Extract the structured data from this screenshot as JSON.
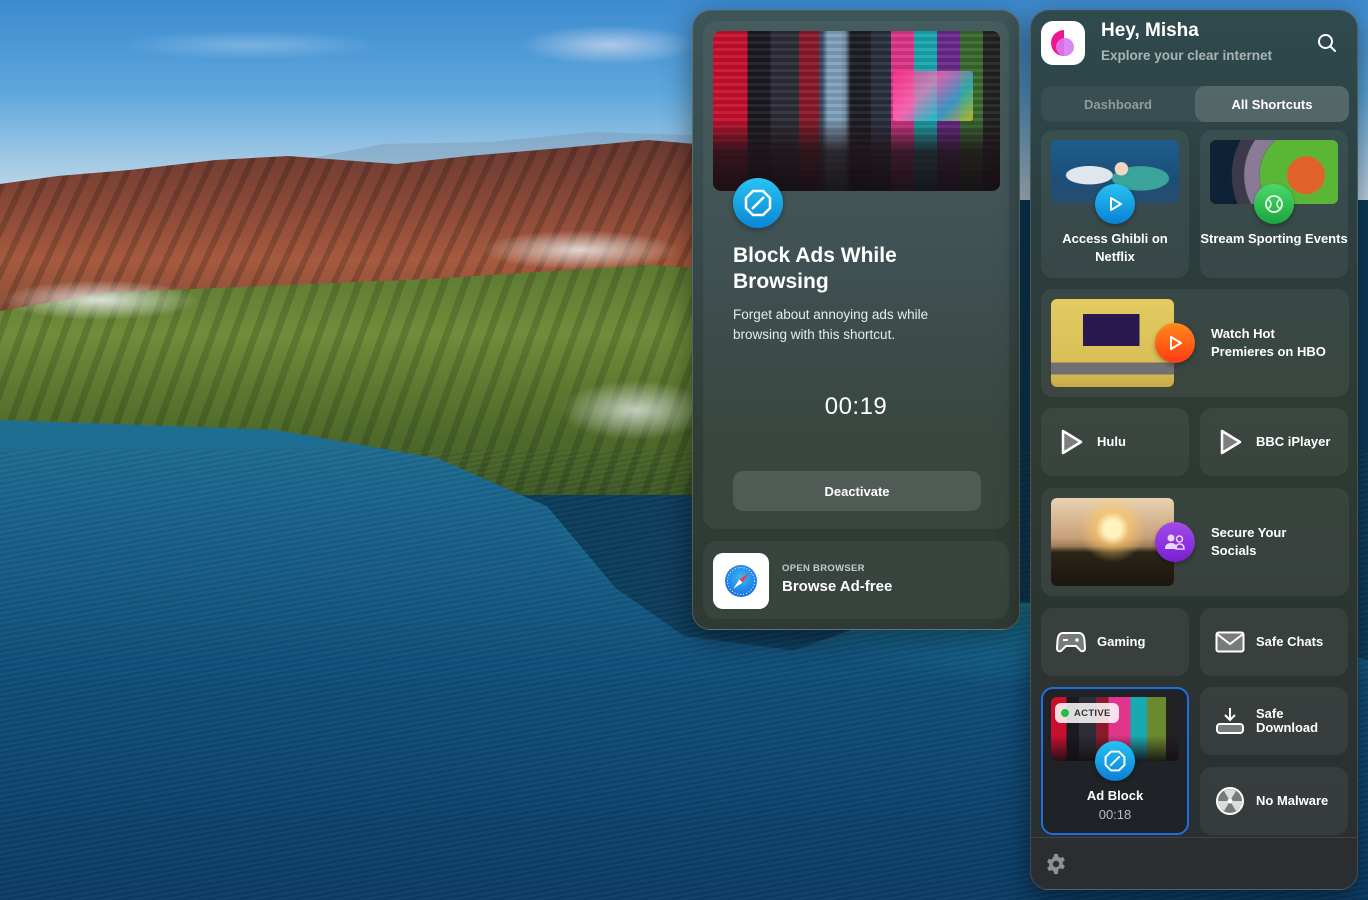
{
  "detail": {
    "title": "Block Ads While Browsing",
    "description": "Forget about annoying ads while browsing with this shortcut.",
    "timer": "00:19",
    "deactivate_label": "Deactivate",
    "browser": {
      "subtitle": "OPEN BROWSER",
      "title": "Browse Ad-free"
    }
  },
  "app": {
    "greeting": "Hey, Misha",
    "tagline": "Explore your clear internet",
    "tabs": [
      {
        "label": "Dashboard",
        "active": false
      },
      {
        "label": "All Shortcuts",
        "active": true
      }
    ],
    "shortcuts": [
      {
        "label": "Access Ghibli on Netflix",
        "icon": "play-icon",
        "badge_color": "#1a9fe6"
      },
      {
        "label": "Stream Sporting Events",
        "icon": "tennis-ball-icon",
        "badge_color": "#2fc254"
      },
      {
        "label": "Watch Hot Premieres on HBO",
        "icon": "play-icon",
        "badge_color": "#ff5a16"
      },
      {
        "label": "Hulu",
        "icon": "play-icon"
      },
      {
        "label": "BBC iPlayer",
        "icon": "play-icon"
      },
      {
        "label": "Secure Your Socials",
        "icon": "users-icon",
        "badge_color": "#8e35dd"
      },
      {
        "label": "Gaming",
        "icon": "gamepad-icon"
      },
      {
        "label": "Safe Chats",
        "icon": "envelope-icon"
      },
      {
        "label": "Ad Block",
        "icon": "block-icon",
        "badge_color": "#1a9fe6",
        "status": "ACTIVE",
        "timer": "00:18"
      },
      {
        "label": "Safe Download",
        "icon": "download-icon"
      },
      {
        "label": "No Malware",
        "icon": "radiation-icon"
      }
    ]
  },
  "colors": {
    "accent_blue": "#1d6fe0",
    "active_green": "#1ec24a",
    "logo_pink": "#f0168f"
  }
}
